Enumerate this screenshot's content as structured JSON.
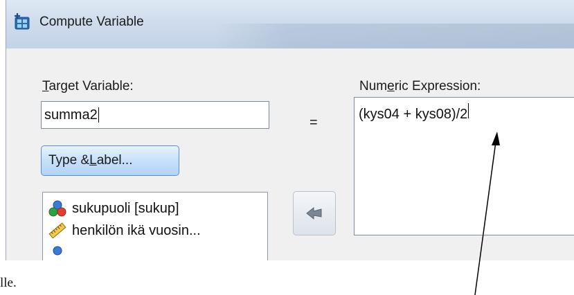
{
  "window": {
    "title": "Compute Variable",
    "icon": "compute-calculator-icon"
  },
  "target_variable": {
    "label_prefix": "",
    "label_accel": "T",
    "label_rest": "arget Variable:",
    "value": "summa2"
  },
  "equals_sign": "=",
  "numeric_expression": {
    "label_pre": "Num",
    "label_accel": "e",
    "label_post": "ric Expression:",
    "value": "(kys04 + kys08)/2"
  },
  "type_label_button": {
    "pre": "Type & ",
    "accel": "L",
    "post": "abel..."
  },
  "variable_list": [
    {
      "label": "sukupuoli [sukup]",
      "icon": "nominal-variable-icon"
    },
    {
      "label": "henkilön ikä vuosin...",
      "icon": "scale-ruler-icon"
    },
    {
      "label": "...",
      "icon": "nominal-variable-icon"
    }
  ],
  "move_button": {
    "icon": "arrow-left-icon"
  },
  "annotation": {
    "icon": "pointer-arrow-icon"
  },
  "below_text": "lle."
}
